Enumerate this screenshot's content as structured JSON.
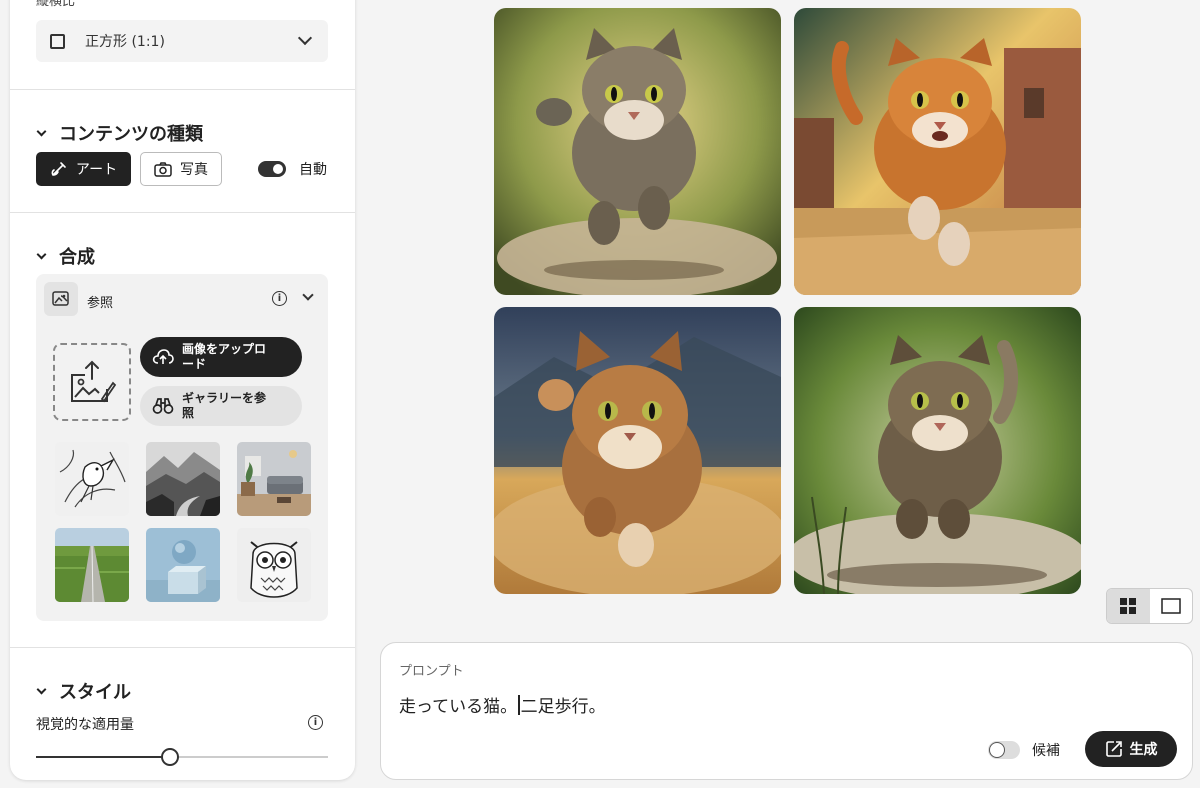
{
  "sidebar": {
    "aspect_label": "縦横比",
    "aspect_value": "正方形 (1:1)",
    "content_type": {
      "title": "コンテンツの種類",
      "art_label": "アート",
      "photo_label": "写真",
      "auto_label": "自動"
    },
    "composition": {
      "title": "合成",
      "reference_label": "参照",
      "upload_label": "画像をアップロード",
      "gallery_label": "ギャラリーを参照",
      "thumbnails": [
        "bird-line-art",
        "misty-mountains",
        "living-room",
        "green-road",
        "sphere-on-cube",
        "owl-line-art"
      ]
    },
    "style": {
      "title": "スタイル",
      "strength_label": "視覚的な適用量",
      "strength_value": 0.46
    }
  },
  "gallery": {
    "images": [
      "running-cat-1",
      "running-cat-2",
      "running-cat-3",
      "running-cat-4"
    ]
  },
  "prompt": {
    "label": "プロンプト",
    "text_before_caret": "走っている猫。",
    "text_after_caret": "二足歩行。",
    "suggest_label": "候補",
    "generate_label": "生成"
  }
}
